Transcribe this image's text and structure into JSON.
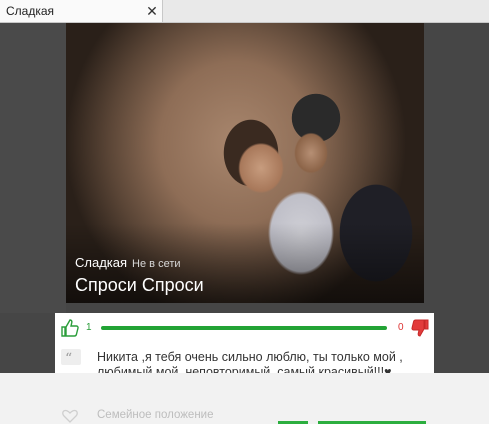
{
  "tab": {
    "title": "Сладкая",
    "close_glyph": "✕"
  },
  "profile": {
    "name": "Сладкая",
    "status": "Не в сети",
    "question": "Спроси Спроси"
  },
  "votes": {
    "likes": "1",
    "dislikes": "0",
    "like_fraction": 1.0,
    "like_icon": "thumbs-up-icon",
    "dislike_icon": "thumbs-down-icon",
    "colors": {
      "like": "#2a9d3a",
      "dislike": "#d33333",
      "bar": "#22a335"
    }
  },
  "answer": {
    "icon": "quote-icon",
    "text": "Никита ,я тебя очень сильно люблю, ты только мой , любимый мой ,неповторимый, самый красивый!!!♥"
  },
  "next_item": {
    "icon": "heart-icon",
    "label": "Семейное положение"
  }
}
